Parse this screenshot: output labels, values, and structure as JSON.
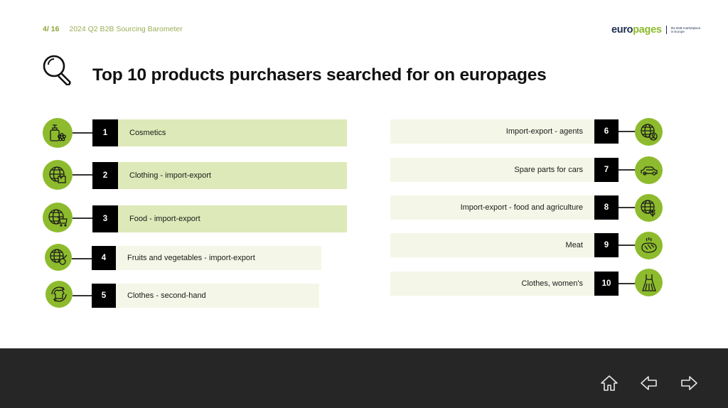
{
  "header": {
    "page_indicator": "4/ 16",
    "report_title": "2024 Q2 B2B Sourcing Barometer",
    "logo": {
      "part1": "euro",
      "part2": "pages",
      "tagline": "the B2B marketplace in Europe"
    }
  },
  "slide": {
    "title": "Top 10 products purchasers searched for on europages",
    "title_icon": "search-icon"
  },
  "items": [
    {
      "rank": "1",
      "label": "Cosmetics",
      "icon": "cosmetics-icon"
    },
    {
      "rank": "2",
      "label": "Clothing - import-export",
      "icon": "globe-clothing-icon"
    },
    {
      "rank": "3",
      "label": "Food - import-export",
      "icon": "globe-cart-icon"
    },
    {
      "rank": "4",
      "label": "Fruits and vegetables - import-export",
      "icon": "globe-fruit-icon"
    },
    {
      "rank": "5",
      "label": "Clothes - second-hand",
      "icon": "recycle-shirt-icon"
    },
    {
      "rank": "6",
      "label": "Import-export - agents",
      "icon": "globe-agent-icon"
    },
    {
      "rank": "7",
      "label": "Spare parts for cars",
      "icon": "car-icon"
    },
    {
      "rank": "8",
      "label": "Import-export - food and agriculture",
      "icon": "globe-leaf-icon"
    },
    {
      "rank": "9",
      "label": "Meat",
      "icon": "steak-icon"
    },
    {
      "rank": "10",
      "label": "Clothes, women's",
      "icon": "dress-icon"
    }
  ],
  "colors": {
    "accent_green": "#8dbb2d",
    "bar_top": "#dde9b8",
    "bar_other": "#f4f7e7",
    "rank_box": "#000000",
    "footer": "#262626"
  },
  "footer": {
    "nav": [
      {
        "name": "home",
        "icon": "home-icon"
      },
      {
        "name": "previous",
        "icon": "arrow-left-icon"
      },
      {
        "name": "next",
        "icon": "arrow-right-icon"
      }
    ]
  }
}
